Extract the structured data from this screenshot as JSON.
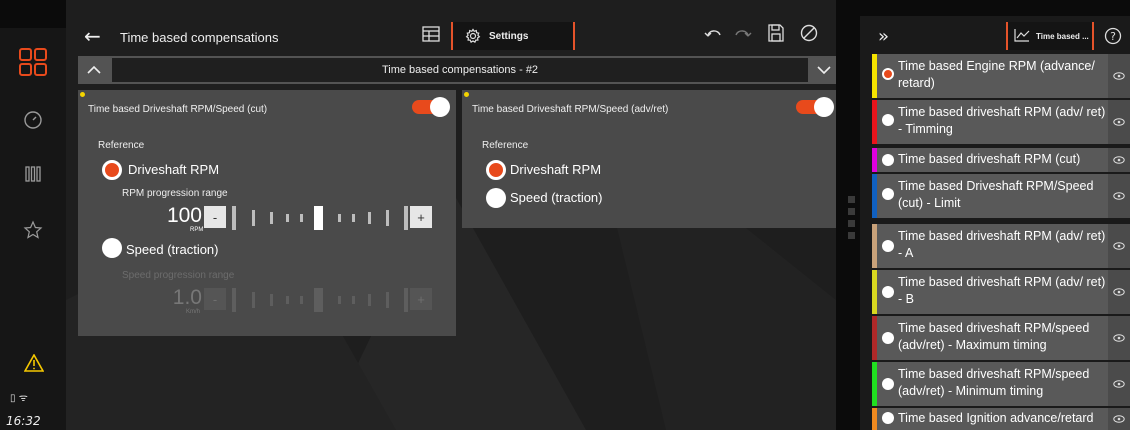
{
  "window": {
    "title": "Time based compensations",
    "settings_tab": "Settings",
    "collapse_title": "Time based compensations - #2"
  },
  "status": {
    "clock": "16:32"
  },
  "cards": [
    {
      "title": "Time based Driveshaft RPM/Speed (cut)",
      "enabled": true,
      "reference_label": "Reference",
      "option_rpm": "Driveshaft RPM",
      "option_speed": "Speed (traction)",
      "rpm_range_label": "RPM progression range",
      "rpm_value": "100",
      "rpm_unit": "RPM",
      "speed_range_label": "Speed progression range",
      "speed_value": "1.0",
      "speed_unit": "Km/h",
      "minus": "-",
      "plus": "+"
    },
    {
      "title": "Time based Driveshaft RPM/Speed (adv/ret)",
      "enabled": true,
      "reference_label": "Reference",
      "option_rpm": "Driveshaft RPM",
      "option_speed": "Speed (traction)"
    }
  ],
  "right_panel": {
    "tab_label": "Time based ...",
    "items": [
      {
        "label": "Time based Engine RPM (advance/ retard)",
        "color": "#f5e400",
        "selected": true
      },
      {
        "label": "Time based driveshaft RPM (adv/ ret) - Timming",
        "color": "#e8141c",
        "selected": false
      },
      {
        "label": "Time based driveshaft RPM (cut)",
        "color": "#e000e0",
        "selected": false
      },
      {
        "label": "Time based Driveshaft RPM/Speed (cut) - Limit",
        "color": "#1060c0",
        "selected": false
      },
      {
        "label": "Time based driveshaft RPM (adv/ ret) - A",
        "color": "#c9a27a",
        "selected": false
      },
      {
        "label": "Time based driveshaft RPM (adv/ ret) - B",
        "color": "#d8d820",
        "selected": false
      },
      {
        "label": "Time based driveshaft RPM/speed (adv/ret) - Maximum timing",
        "color": "#b02828",
        "selected": false
      },
      {
        "label": "Time based driveshaft RPM/speed (adv/ret) - Minimum timing",
        "color": "#20e020",
        "selected": false
      },
      {
        "label": "Time based Ignition advance/retard",
        "color": "#f08a20",
        "selected": false
      }
    ]
  },
  "accent": "#e84a1c",
  "icons": [
    "apps-icon",
    "gauge-icon",
    "columns-icon",
    "star-icon",
    "warning-icon",
    "battery-icon",
    "wifi-icon",
    "back-arrow-icon",
    "table-icon",
    "gear-icon",
    "undo-icon",
    "redo-icon",
    "save-icon",
    "cancel-icon",
    "chevron-up-icon",
    "chevron-down-icon",
    "collapse-right-icon",
    "chart-icon",
    "help-icon",
    "eye-icon"
  ]
}
